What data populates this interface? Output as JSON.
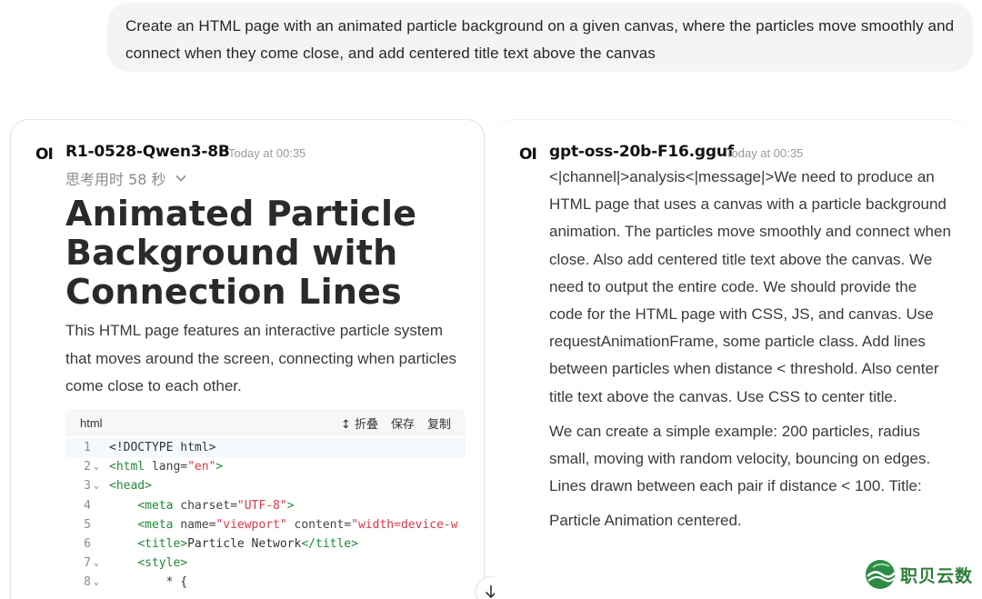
{
  "prompt": {
    "text": "Create an HTML page with an animated particle background on a given canvas, where the particles move smoothly and connect when they come close, and add centered title text above the canvas"
  },
  "left_response": {
    "logo": "OI",
    "model_name": "R1-0528-Qwen3-8B",
    "timestamp": "Today at 00:35",
    "thinking_label": "思考用时 58 秒",
    "heading": "Animated Particle Background with Connection Lines",
    "intro": "This HTML page features an interactive particle system that moves around the screen, connecting when particles come close to each other.",
    "code": {
      "language": "html",
      "actions": {
        "collapse": "折叠",
        "save": "保存",
        "copy": "复制"
      },
      "lines": [
        {
          "num": "1",
          "fold": false
        },
        {
          "num": "2",
          "fold": true
        },
        {
          "num": "3",
          "fold": true
        },
        {
          "num": "4",
          "fold": false
        },
        {
          "num": "5",
          "fold": false
        },
        {
          "num": "6",
          "fold": false
        },
        {
          "num": "7",
          "fold": true
        },
        {
          "num": "8",
          "fold": true
        }
      ]
    }
  },
  "right_response": {
    "logo": "OI",
    "model_name": "gpt-oss-20b-F16.gguf",
    "timestamp": "Today at 00:35",
    "paragraphs": [
      "<|channel|>analysis<|message|>We need to produce an HTML page that uses a canvas with a particle background animation. The particles move smoothly and connect when close. Also add centered title text above the canvas. We need to output the entire code. We should provide the code for the HTML page with CSS, JS, and canvas. Use requestAnimationFrame, some particle class. Add lines between particles when distance < threshold. Also center title text above the canvas. Use CSS to center title.",
      "We can create a simple example: 200 particles, radius small, moving with random velocity, bouncing on edges. Lines drawn between each pair if distance < 100. Title:",
      "Particle Animation centered."
    ]
  },
  "watermark": {
    "text": "职贝云数"
  }
}
